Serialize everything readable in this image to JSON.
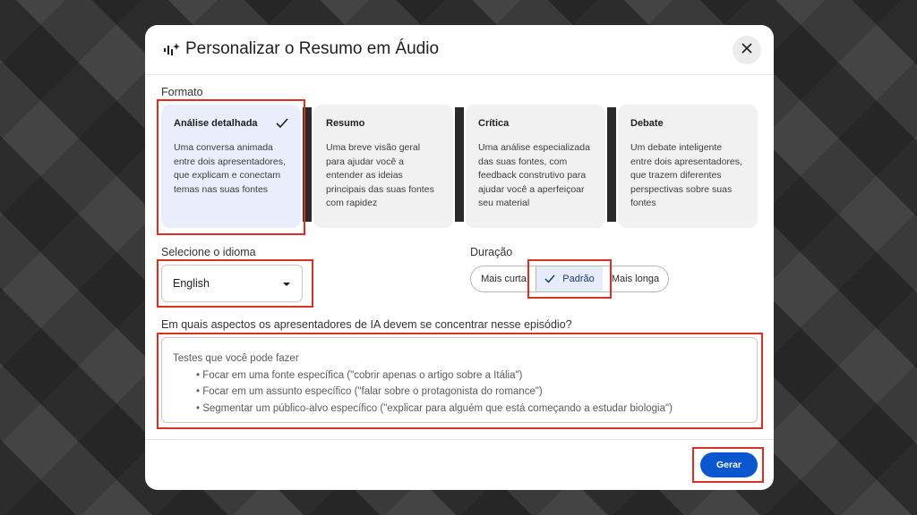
{
  "dialog": {
    "title": "Personalizar o Resumo em Áudio",
    "format_label": "Formato",
    "formats": [
      {
        "title": "Análise detalhada",
        "desc": "Uma conversa animada entre dois apresentadores, que explicam e conectam temas nas suas fontes",
        "selected": true
      },
      {
        "title": "Resumo",
        "desc": "Uma breve visão geral para ajudar você a entender as ideias principais das suas fontes com rapidez",
        "selected": false
      },
      {
        "title": "Crítica",
        "desc": "Uma análise especializada das suas fontes, com feedback construtivo para ajudar você a aperfeiçoar seu material",
        "selected": false
      },
      {
        "title": "Debate",
        "desc": "Um debate inteligente entre dois apresentadores, que trazem diferentes perspectivas sobre suas fontes",
        "selected": false
      }
    ],
    "language_label": "Selecione o idioma",
    "language_value": "English",
    "duration_label": "Duração",
    "duration_options": [
      "Mais curta",
      "Padrão",
      "Mais longa"
    ],
    "duration_selected": "Padrão",
    "focus_label": "Em quais aspectos os apresentadores de IA devem se concentrar nesse episódio?",
    "placeholder_intro": "Testes que você pode fazer",
    "placeholder_bullets": [
      "• Focar em uma fonte específica (\"cobrir apenas o artigo sobre a Itália\")",
      "• Focar em um assunto específico (\"falar sobre o protagonista do romance\")",
      "• Segmentar um público-alvo específico (\"explicar para alguém que está começando a estudar biologia\")"
    ],
    "generate_label": "Gerar"
  },
  "colors": {
    "accent": "#0b57d0",
    "highlight": "#d93025",
    "selected_card": "#eaedfb"
  },
  "icons": {
    "header": "audio-sparkle-icon",
    "close": "close-icon",
    "check": "check-icon",
    "dropdown": "dropdown-arrow-icon"
  }
}
